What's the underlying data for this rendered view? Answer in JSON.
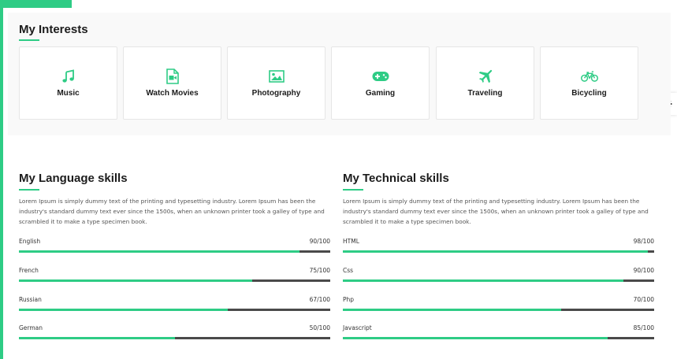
{
  "colors": {
    "accent": "#2ecc85",
    "track": "#4a4a4a"
  },
  "interests": {
    "title": "My Interests",
    "items": [
      {
        "label": "Music",
        "icon": "music-icon"
      },
      {
        "label": "Watch Movies",
        "icon": "video-file-icon"
      },
      {
        "label": "Photography",
        "icon": "image-icon"
      },
      {
        "label": "Gaming",
        "icon": "gamepad-icon"
      },
      {
        "label": "Traveling",
        "icon": "plane-icon"
      },
      {
        "label": "Bicycling",
        "icon": "bicycle-icon"
      }
    ]
  },
  "language": {
    "title": "My Language skills",
    "description": "Lorem Ipsum is simply dummy text of the printing and typesetting industry. Lorem Ipsum has been the industry's standard dummy text ever since the 1500s, when an unknown printer took a galley of type and scrambled it to make a type specimen book.",
    "skills": [
      {
        "name": "English",
        "score": "90/100",
        "value": 90
      },
      {
        "name": "French",
        "score": "75/100",
        "value": 75
      },
      {
        "name": "Russian",
        "score": "67/100",
        "value": 67
      },
      {
        "name": "German",
        "score": "50/100",
        "value": 50
      }
    ]
  },
  "technical": {
    "title": "My Technical skills",
    "description": "Lorem Ipsum is simply dummy text of the printing and typesetting industry. Lorem Ipsum has been the industry's standard dummy text ever since the 1500s, when an unknown printer took a galley of type and scrambled it to make a type specimen book.",
    "skills": [
      {
        "name": "HTML",
        "score": "98/100",
        "value": 98
      },
      {
        "name": "Css",
        "score": "90/100",
        "value": 90
      },
      {
        "name": "Php",
        "score": "70/100",
        "value": 70
      },
      {
        "name": "Javascript",
        "score": "85/100",
        "value": 85
      }
    ]
  }
}
